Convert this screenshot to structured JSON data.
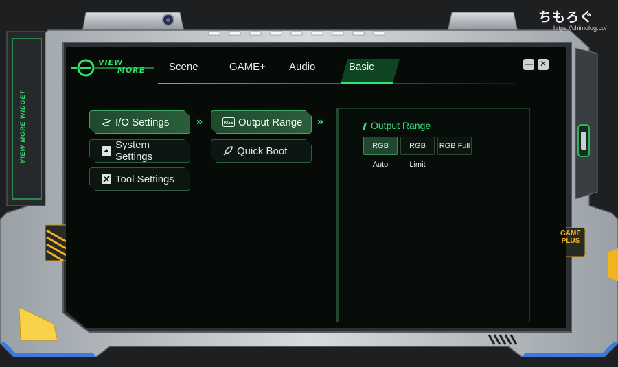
{
  "watermark": {
    "name": "ちもろぐ",
    "url": "https://chimolog.co/"
  },
  "app": {
    "logo_line1": "VIEW",
    "logo_line2": "MORE",
    "vertical_label": "VIEW MORE WIDGET",
    "badge_line1": "GAME",
    "badge_line2": "PLUS"
  },
  "tabs": [
    {
      "label": "Scene",
      "active": false
    },
    {
      "label": "GAME+",
      "active": false
    },
    {
      "label": "Audio",
      "active": false
    },
    {
      "label": "Basic",
      "active": true
    }
  ],
  "window_controls": {
    "minimize": "—",
    "close": "✕"
  },
  "menu_left": [
    {
      "label": "I/O Settings",
      "icon": "io-settings-icon",
      "active": true
    },
    {
      "label": "System Settings",
      "icon": "system-settings-icon",
      "active": false
    },
    {
      "label": "Tool Settings",
      "icon": "tool-settings-icon",
      "active": false
    }
  ],
  "menu_mid": [
    {
      "label": "Output Range",
      "icon": "rgb-icon",
      "icon_text": "RGB",
      "active": true
    },
    {
      "label": "Quick Boot",
      "icon": "rocket-icon",
      "active": false
    }
  ],
  "chevrons": "»",
  "panel": {
    "title": "Output Range",
    "options": [
      {
        "label": "RGB Auto",
        "active": true
      },
      {
        "label": "RGB Limit",
        "active": false
      },
      {
        "label": "RGB Full",
        "active": false
      }
    ]
  },
  "colors": {
    "accent": "#35e27a",
    "badge": "#f2b321",
    "frame": "#b9bec2"
  }
}
